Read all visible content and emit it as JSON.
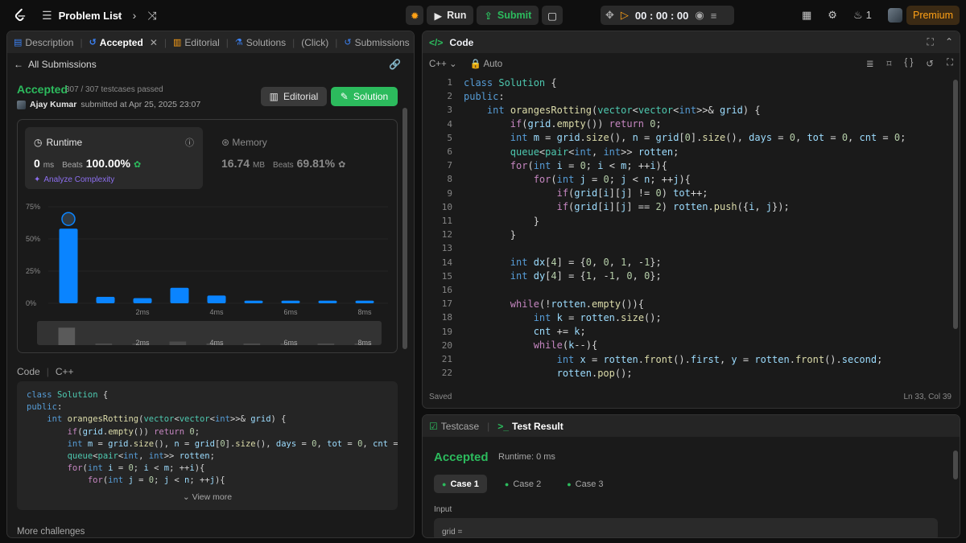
{
  "topbar": {
    "problem_list": "Problem List",
    "run": "Run",
    "submit": "Submit",
    "timer": "00 : 00 : 00",
    "streak": "1",
    "premium": "Premium"
  },
  "left_tabs": [
    "Description",
    "Accepted",
    "Editorial",
    "Solutions",
    "(Click)",
    "Submissions"
  ],
  "submission": {
    "back": "All Submissions",
    "status": "Accepted",
    "testcases": "307 / 307 testcases passed",
    "user": "Ajay Kumar",
    "submitted_at": "submitted at Apr 25, 2025 23:07",
    "editorial_btn": "Editorial",
    "solution_btn": "Solution"
  },
  "runtime": {
    "label": "Runtime",
    "value": "0",
    "unit": "ms",
    "beats_label": "Beats",
    "beats": "100.00%",
    "analyze": "Analyze Complexity"
  },
  "memory": {
    "label": "Memory",
    "value": "16.74",
    "unit": "MB",
    "beats_label": "Beats",
    "beats": "69.81%"
  },
  "chart_data": {
    "type": "bar",
    "yticks": [
      "75%",
      "50%",
      "25%",
      "0%"
    ],
    "ylim": [
      0,
      75
    ],
    "categories": [
      "0ms",
      "1ms",
      "2ms",
      "3ms",
      "4ms",
      "5ms",
      "6ms",
      "7ms",
      "8ms"
    ],
    "xtick_labels": [
      "2ms",
      "4ms",
      "6ms",
      "8ms"
    ],
    "values": [
      58,
      5,
      4,
      12,
      6,
      2,
      2,
      2,
      2
    ],
    "highlight_index": 0,
    "bar_color": "#0a84ff"
  },
  "code_preview": {
    "header": "Code",
    "lang": "C++",
    "lines": [
      "class Solution {",
      "public:",
      "    int orangesRotting(vector<vector<int>>& grid) {",
      "        if(grid.empty()) return 0;",
      "        int m = grid.size(), n = grid[0].size(), days = 0, tot = 0, cnt =",
      "        queue<pair<int, int>> rotten;",
      "        for(int i = 0; i < m; ++i){",
      "            for(int j = 0; j < n; ++j){"
    ],
    "view_more": "View more",
    "more_challenges": "More challenges"
  },
  "code_panel": {
    "title": "Code",
    "lang": "C++",
    "mode": "Auto",
    "status": "Saved",
    "cursor": "Ln 33, Col 39",
    "lines": [
      {
        "n": "1",
        "t": "class Solution {"
      },
      {
        "n": "2",
        "t": "public:"
      },
      {
        "n": "3",
        "t": "    int orangesRotting(vector<vector<int>>& grid) {"
      },
      {
        "n": "4",
        "t": "        if(grid.empty()) return 0;"
      },
      {
        "n": "5",
        "t": "        int m = grid.size(), n = grid[0].size(), days = 0, tot = 0, cnt = 0;"
      },
      {
        "n": "6",
        "t": "        queue<pair<int, int>> rotten;"
      },
      {
        "n": "7",
        "t": "        for(int i = 0; i < m; ++i){"
      },
      {
        "n": "8",
        "t": "            for(int j = 0; j < n; ++j){"
      },
      {
        "n": "9",
        "t": "                if(grid[i][j] != 0) tot++;"
      },
      {
        "n": "10",
        "t": "                if(grid[i][j] == 2) rotten.push({i, j});"
      },
      {
        "n": "11",
        "t": "            }"
      },
      {
        "n": "12",
        "t": "        }"
      },
      {
        "n": "13",
        "t": ""
      },
      {
        "n": "14",
        "t": "        int dx[4] = {0, 0, 1, -1};"
      },
      {
        "n": "15",
        "t": "        int dy[4] = {1, -1, 0, 0};"
      },
      {
        "n": "16",
        "t": ""
      },
      {
        "n": "17",
        "t": "        while(!rotten.empty()){"
      },
      {
        "n": "18",
        "t": "            int k = rotten.size();"
      },
      {
        "n": "19",
        "t": "            cnt += k;"
      },
      {
        "n": "20",
        "t": "            while(k--){"
      },
      {
        "n": "21",
        "t": "                int x = rotten.front().first, y = rotten.front().second;"
      },
      {
        "n": "22",
        "t": "                rotten.pop();"
      }
    ]
  },
  "test_panel": {
    "tab_testcase": "Testcase",
    "tab_result": "Test Result",
    "status": "Accepted",
    "runtime": "Runtime: 0 ms",
    "cases": [
      "Case 1",
      "Case 2",
      "Case 3"
    ],
    "input_label": "Input",
    "input_value": "grid ="
  }
}
